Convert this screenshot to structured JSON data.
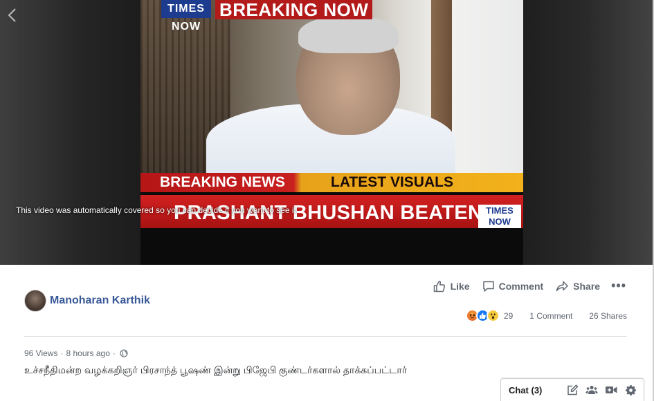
{
  "video": {
    "notice": "This video was automatically covered so you can decide if you want to see it.",
    "overlay_logo_top": "TIMES NOW",
    "overlay_breaking_now": "BREAKING NOW",
    "ticker_left": "BREAKING NEWS",
    "ticker_right": "LATEST VISUALS",
    "ticker_headline": "PRASHANT BHUSHAN BEATEN UP",
    "overlay_logo_bottom": "TIMES NOW"
  },
  "actions": {
    "like": "Like",
    "comment": "Comment",
    "share": "Share",
    "more": "•••"
  },
  "author": {
    "name": "Manoharan Karthik"
  },
  "stats": {
    "reactions_count": "29",
    "comments": "1 Comment",
    "shares": "26 Shares",
    "reaction_icons": [
      "angry-reaction-icon",
      "like-reaction-icon",
      "wow-reaction-icon"
    ]
  },
  "meta": {
    "views": "96 Views",
    "separator": "·",
    "time": "8 hours ago",
    "privacy_icon": "globe-icon"
  },
  "post": {
    "text": "உச்சநீதிமன்ற வழக்கறிஞர் பிரசாந்த் பூஷண் இன்று பிஜேபி குண்டர்களால் தாக்கப்பட்டார்"
  },
  "chat": {
    "label": "Chat (3)",
    "icons": [
      "compose-icon",
      "group-icon",
      "video-call-icon",
      "settings-gear-icon"
    ]
  },
  "colors": {
    "link_blue": "#385898",
    "muted_text": "#606770",
    "like_blue": "#1877f2",
    "breaking_red": "#b31b1b",
    "ticker_yellow": "#f2b21b"
  }
}
